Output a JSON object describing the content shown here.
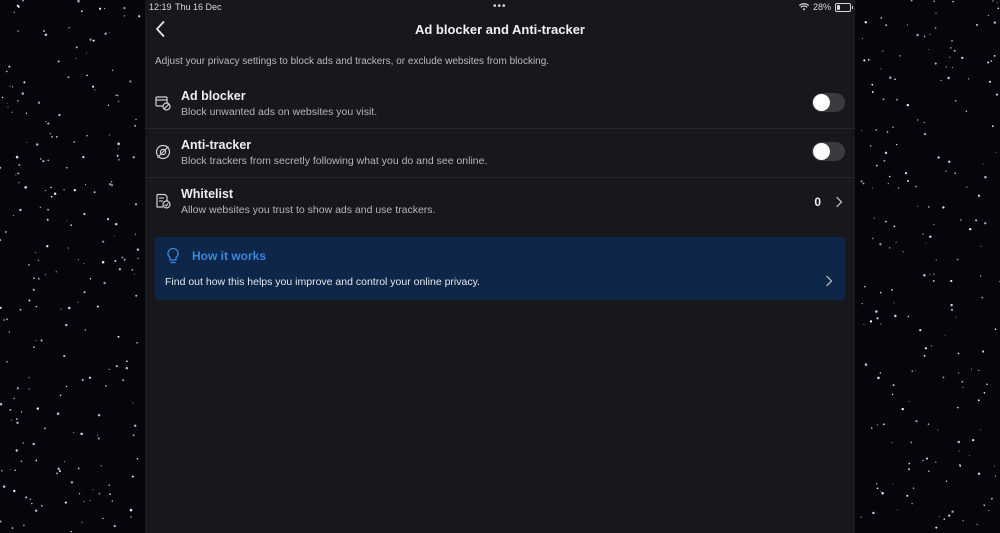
{
  "status_bar": {
    "time": "12:19",
    "date": "Thu 16 Dec",
    "battery": "28%",
    "battery_level": 0.28
  },
  "nav": {
    "title": "Ad blocker and Anti-tracker"
  },
  "description": "Adjust your privacy settings to block ads and trackers, or exclude websites from blocking.",
  "settings": [
    {
      "id": "ad-blocker",
      "icon": "ad-blocker-icon",
      "title": "Ad blocker",
      "subtitle": "Block unwanted ads on websites you visit.",
      "control": "toggle",
      "enabled": false
    },
    {
      "id": "anti-tracker",
      "icon": "anti-tracker-icon",
      "title": "Anti-tracker",
      "subtitle": "Block trackers from secretly following what you do and see online.",
      "control": "toggle",
      "enabled": false
    },
    {
      "id": "whitelist",
      "icon": "whitelist-icon",
      "title": "Whitelist",
      "subtitle": "Allow websites you trust to show ads and use trackers.",
      "control": "count",
      "count": "0"
    }
  ],
  "how_it_works": {
    "icon": "lightbulb-icon",
    "title": "How it works",
    "text": "Find out how this helps you improve and control your online privacy."
  },
  "colors": {
    "background": "#05060b",
    "panel": "#17181c",
    "card": "#0e2749",
    "accent": "#3a86df"
  }
}
